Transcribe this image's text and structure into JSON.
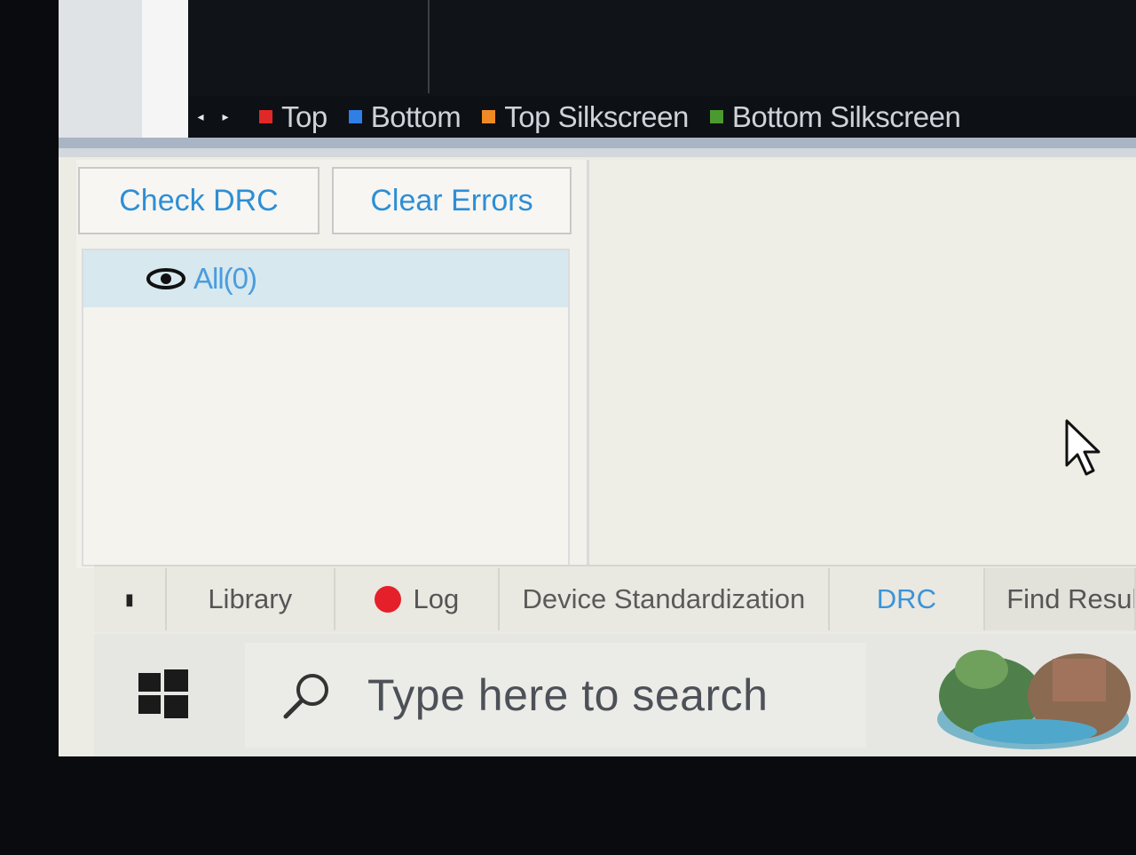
{
  "layers": {
    "prev_icon": "caret-left-icon",
    "next_icon": "caret-right-icon",
    "items": [
      {
        "label": "Top",
        "color": "#e02828"
      },
      {
        "label": "Bottom",
        "color": "#2f7fe6"
      },
      {
        "label": "Top Silkscreen",
        "color": "#f08a24"
      },
      {
        "label": "Bottom Silkscreen",
        "color": "#4a9a2f"
      }
    ]
  },
  "drc_panel": {
    "check_label": "Check DRC",
    "clear_label": "Clear Errors",
    "tree": {
      "label": "All(0)",
      "icon": "eye-icon"
    }
  },
  "tabs": {
    "library": "Library",
    "log": "Log",
    "device": "Device Standardization",
    "drc": "DRC",
    "find": "Find Resul"
  },
  "taskbar": {
    "search_placeholder": "Type here to search"
  },
  "colors": {
    "accent": "#2d8ed6",
    "log_dot": "#e5202a"
  }
}
